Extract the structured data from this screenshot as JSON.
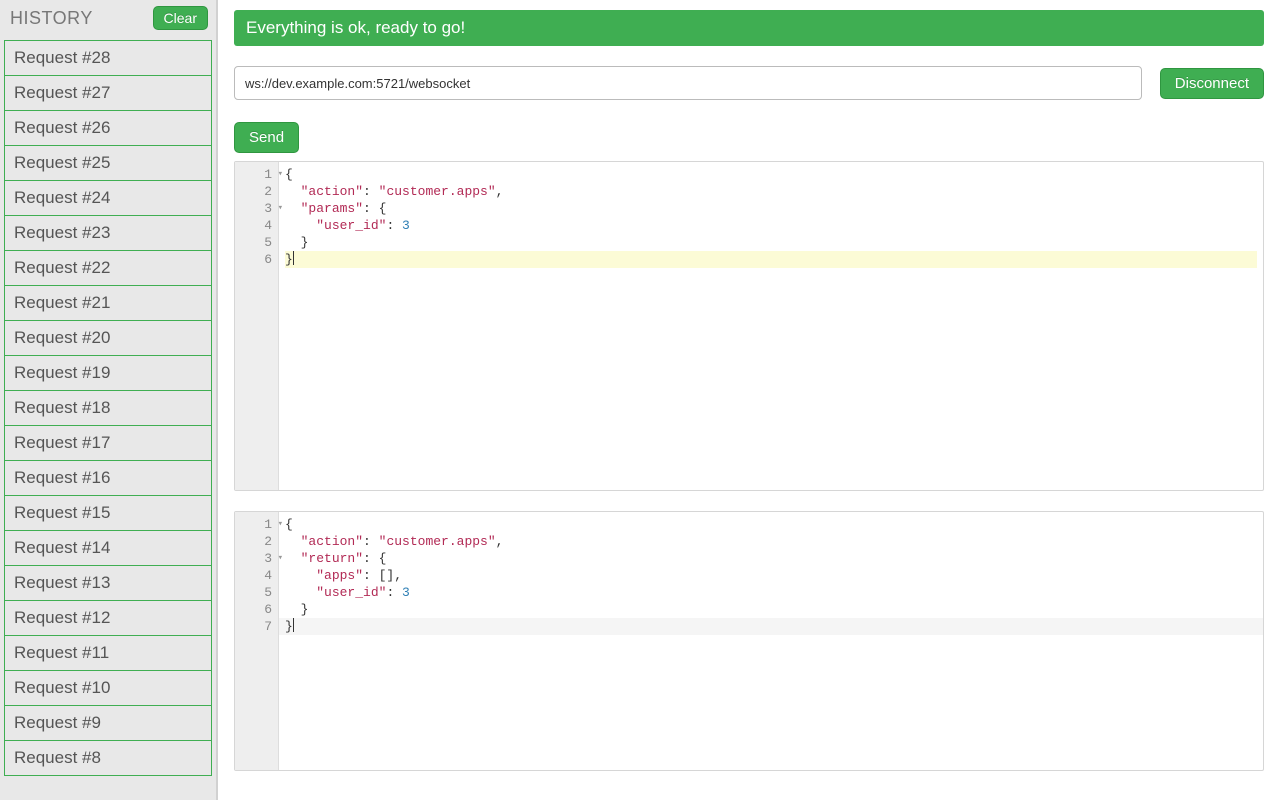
{
  "sidebar": {
    "title": "HISTORY",
    "clear_label": "Clear",
    "items": [
      {
        "label": "Request #28"
      },
      {
        "label": "Request #27"
      },
      {
        "label": "Request #26"
      },
      {
        "label": "Request #25"
      },
      {
        "label": "Request #24"
      },
      {
        "label": "Request #23"
      },
      {
        "label": "Request #22"
      },
      {
        "label": "Request #21"
      },
      {
        "label": "Request #20"
      },
      {
        "label": "Request #19"
      },
      {
        "label": "Request #18"
      },
      {
        "label": "Request #17"
      },
      {
        "label": "Request #16"
      },
      {
        "label": "Request #15"
      },
      {
        "label": "Request #14"
      },
      {
        "label": "Request #13"
      },
      {
        "label": "Request #12"
      },
      {
        "label": "Request #11"
      },
      {
        "label": "Request #10"
      },
      {
        "label": "Request #9"
      },
      {
        "label": "Request #8"
      }
    ]
  },
  "status": {
    "text": "Everything is ok, ready to go!"
  },
  "connection": {
    "url": "ws://dev.example.com:5721/websocket",
    "disconnect_label": "Disconnect"
  },
  "actions": {
    "send_label": "Send"
  },
  "request_editor": {
    "line_count": 6,
    "fold_lines": [
      1,
      3
    ],
    "active_line": 6,
    "tokens": [
      [
        {
          "t": "punc",
          "v": "{"
        }
      ],
      [
        {
          "t": "pad",
          "v": "  "
        },
        {
          "t": "key",
          "v": "\"action\""
        },
        {
          "t": "punc",
          "v": ": "
        },
        {
          "t": "str",
          "v": "\"customer.apps\""
        },
        {
          "t": "punc",
          "v": ","
        }
      ],
      [
        {
          "t": "pad",
          "v": "  "
        },
        {
          "t": "key",
          "v": "\"params\""
        },
        {
          "t": "punc",
          "v": ": {"
        }
      ],
      [
        {
          "t": "pad",
          "v": "    "
        },
        {
          "t": "key",
          "v": "\"user_id\""
        },
        {
          "t": "punc",
          "v": ": "
        },
        {
          "t": "num",
          "v": "3"
        }
      ],
      [
        {
          "t": "pad",
          "v": "  "
        },
        {
          "t": "punc",
          "v": "}"
        }
      ],
      [
        {
          "t": "punc",
          "v": "}"
        },
        {
          "t": "cursor",
          "v": ""
        }
      ]
    ]
  },
  "response_editor": {
    "line_count": 7,
    "fold_lines": [
      1,
      3
    ],
    "active_line": 7,
    "tokens": [
      [
        {
          "t": "punc",
          "v": "{"
        }
      ],
      [
        {
          "t": "pad",
          "v": "  "
        },
        {
          "t": "key",
          "v": "\"action\""
        },
        {
          "t": "punc",
          "v": ": "
        },
        {
          "t": "str",
          "v": "\"customer.apps\""
        },
        {
          "t": "punc",
          "v": ","
        }
      ],
      [
        {
          "t": "pad",
          "v": "  "
        },
        {
          "t": "key",
          "v": "\"return\""
        },
        {
          "t": "punc",
          "v": ": {"
        }
      ],
      [
        {
          "t": "pad",
          "v": "    "
        },
        {
          "t": "key",
          "v": "\"apps\""
        },
        {
          "t": "punc",
          "v": ": [],"
        }
      ],
      [
        {
          "t": "pad",
          "v": "    "
        },
        {
          "t": "key",
          "v": "\"user_id\""
        },
        {
          "t": "punc",
          "v": ": "
        },
        {
          "t": "num",
          "v": "3"
        }
      ],
      [
        {
          "t": "pad",
          "v": "  "
        },
        {
          "t": "punc",
          "v": "}"
        }
      ],
      [
        {
          "t": "punc",
          "v": "}"
        },
        {
          "t": "cursor",
          "v": ""
        }
      ]
    ]
  }
}
